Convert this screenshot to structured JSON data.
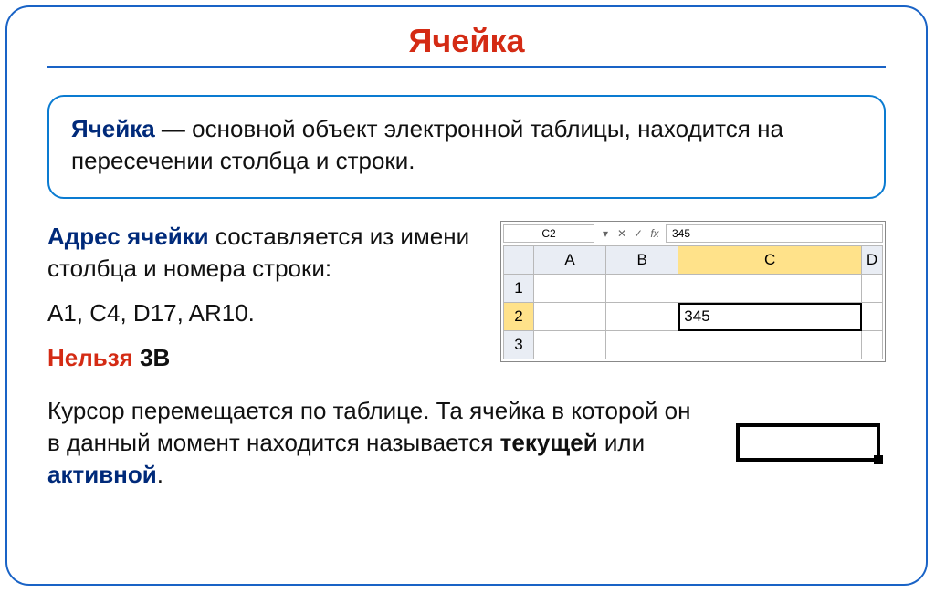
{
  "title": "Ячейка",
  "definition": {
    "term": "Ячейка",
    "rest": " — основной объект электронной таблицы, находится на пересечении столбца и строки."
  },
  "address": {
    "label": "Адрес ячейки",
    "text1": " составляется из имени столбца и номера строки:",
    "examples": "А1, С4, D17, AR10.",
    "no_label": "Нельзя",
    "no_example": " 3В"
  },
  "spreadsheet": {
    "namebox": "C2",
    "fx": "fx",
    "formula_value": "345",
    "columns": [
      "A",
      "B",
      "C",
      "D"
    ],
    "rows": [
      "1",
      "2",
      "3"
    ],
    "active": {
      "row": 2,
      "col": "C",
      "value": "345"
    }
  },
  "cursor_note": {
    "pre": "Курсор перемещается по таблице. Та ячейка в которой он в данный момент находится называется ",
    "current": "текущей",
    "or": " или ",
    "active": "активной",
    "dot": "."
  }
}
